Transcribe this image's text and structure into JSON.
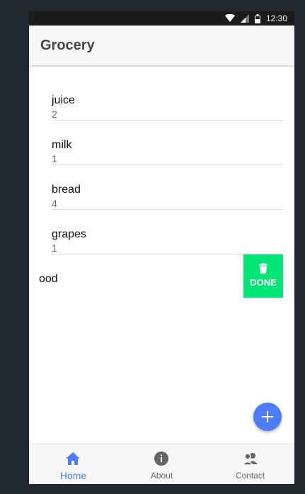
{
  "status_bar": {
    "time": "12:30",
    "icons": [
      "wifi-icon",
      "signal-icon",
      "battery-icon"
    ]
  },
  "app_bar": {
    "title": "Grocery"
  },
  "items": [
    {
      "name": "juice",
      "qty": "2"
    },
    {
      "name": "milk",
      "qty": "1"
    },
    {
      "name": "bread",
      "qty": "4"
    },
    {
      "name": "grapes",
      "qty": "1"
    },
    {
      "name": "food",
      "name_visible": "ood",
      "qty": ""
    }
  ],
  "swipe_action": {
    "label": "DONE",
    "icon": "trash-icon",
    "color": "#00e676"
  },
  "fab": {
    "icon": "plus-icon",
    "color": "#4d7cff"
  },
  "bottom_nav": {
    "tabs": [
      {
        "label": "Home",
        "icon": "home-icon",
        "active": true
      },
      {
        "label": "About",
        "icon": "info-icon",
        "active": false
      },
      {
        "label": "Contact",
        "icon": "contacts-icon",
        "active": false
      }
    ],
    "active_color": "#4d7cff"
  }
}
